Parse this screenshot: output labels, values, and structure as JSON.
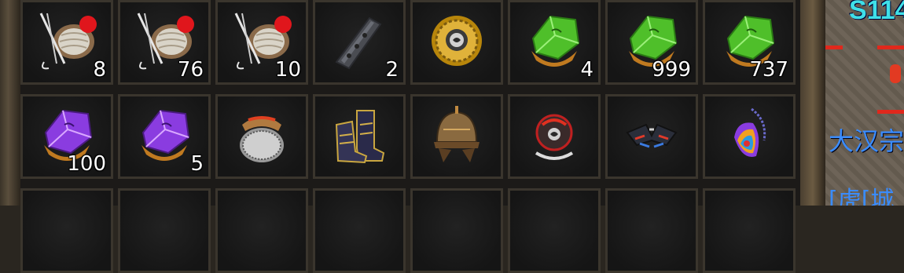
{
  "inventory": {
    "rows": [
      [
        {
          "item": "thread-spool-icon",
          "count": "8"
        },
        {
          "item": "thread-spool-icon",
          "count": "76"
        },
        {
          "item": "thread-spool-icon",
          "count": "10"
        },
        {
          "item": "iron-shard-icon",
          "count": "2"
        },
        {
          "item": "golden-orb-icon",
          "count": ""
        },
        {
          "item": "green-gem-icon",
          "count": "4"
        },
        {
          "item": "green-gem-icon",
          "count": "999"
        },
        {
          "item": "green-gem-icon",
          "count": "737"
        }
      ],
      [
        {
          "item": "purple-gem-icon",
          "count": "100"
        },
        {
          "item": "purple-gem-icon",
          "count": "5"
        },
        {
          "item": "beaded-helmet-icon",
          "count": ""
        },
        {
          "item": "boots-icon",
          "count": ""
        },
        {
          "item": "bronze-helmet-icon",
          "count": ""
        },
        {
          "item": "rune-medal-icon",
          "count": ""
        },
        {
          "item": "winged-armor-icon",
          "count": ""
        },
        {
          "item": "rainbow-amulet-icon",
          "count": ""
        }
      ]
    ]
  },
  "map": {
    "label": "S114",
    "text1": "大汉宗室",
    "text2": "[虎[城"
  },
  "colors": {
    "slot_border": "#3a352d",
    "green_gem": "#4fbf2a",
    "purple_gem": "#8a3ce0",
    "map_label": "#3fe0e8",
    "map_text": "#3a8cff",
    "map_marker": "#e0281c"
  }
}
